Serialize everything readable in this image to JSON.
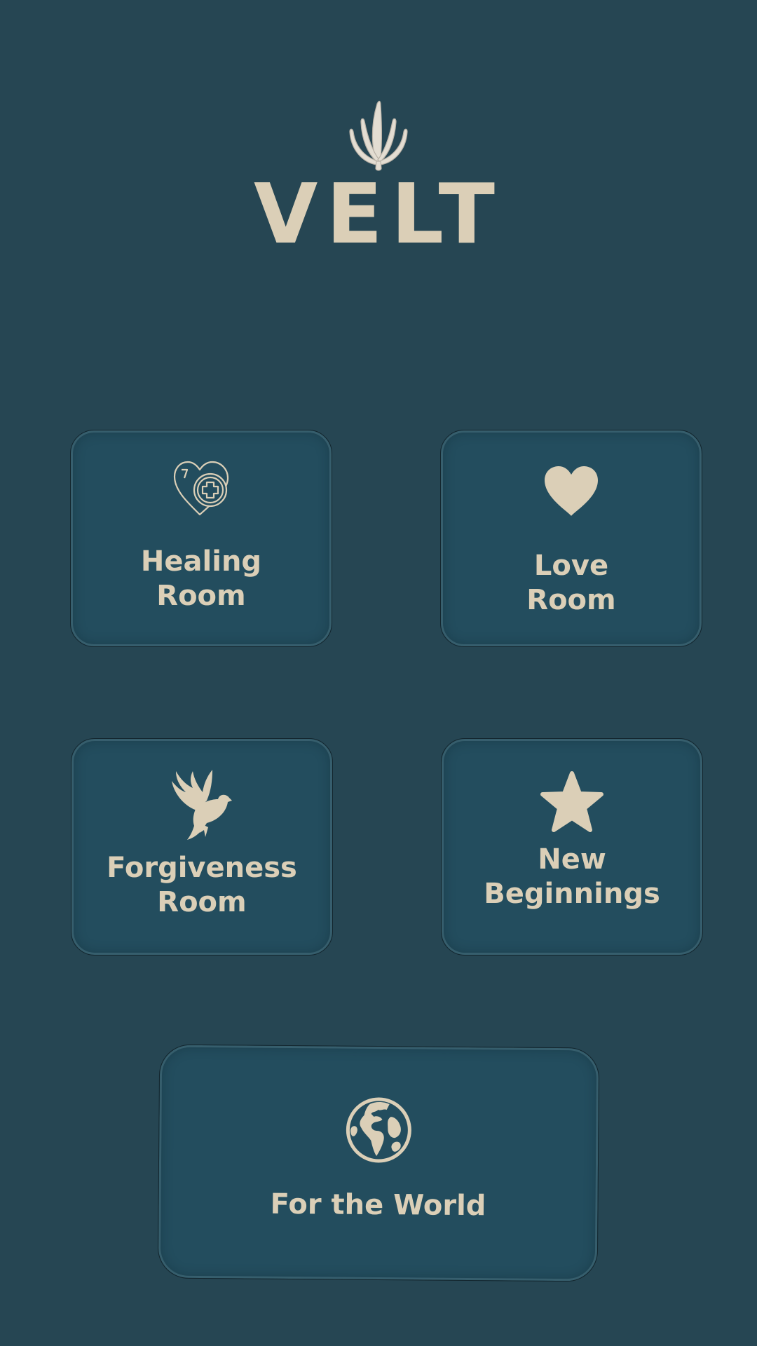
{
  "app": {
    "logo_text": "VELT",
    "logo_icon": "sprout-icon"
  },
  "rooms": [
    {
      "id": "healing",
      "label_lines": [
        "Healing",
        "Room"
      ],
      "icon": "heart-medical-icon"
    },
    {
      "id": "love",
      "label_lines": [
        "Love",
        "Room"
      ],
      "icon": "heart-icon"
    },
    {
      "id": "forgiveness",
      "label_lines": [
        "Forgiveness",
        "Room"
      ],
      "icon": "dove-icon"
    },
    {
      "id": "new_beginnings",
      "label_lines": [
        "New",
        "Beginnings"
      ],
      "icon": "star-icon"
    },
    {
      "id": "world",
      "label_lines": [
        "For the World"
      ],
      "icon": "globe-icon"
    }
  ],
  "colors": {
    "background": "#264653",
    "tile": "#234d5e",
    "accent": "#dbcfb7"
  }
}
